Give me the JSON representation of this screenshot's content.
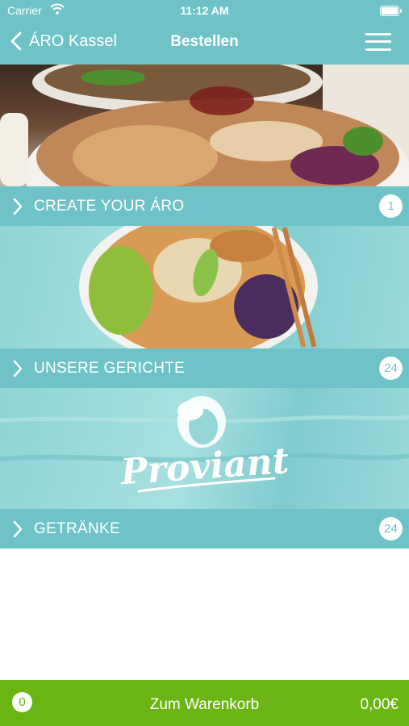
{
  "status_bar": {
    "carrier": "Carrier",
    "time": "11:12 AM"
  },
  "nav": {
    "back_label": "ÁRO Kassel",
    "title": "Bestellen"
  },
  "categories": [
    {
      "label": "CREATE YOUR ÁRO",
      "count": "1"
    },
    {
      "label": "UNSERE GERICHTE",
      "count": "24"
    },
    {
      "label": "GETRÄNKE",
      "count": "24"
    }
  ],
  "logo": {
    "text": "Proviant"
  },
  "cart": {
    "count": "0",
    "label": "Zum Warenkorb",
    "total": "0,00€"
  },
  "colors": {
    "primary": "#6fc3c8",
    "cart": "#6ab513"
  }
}
